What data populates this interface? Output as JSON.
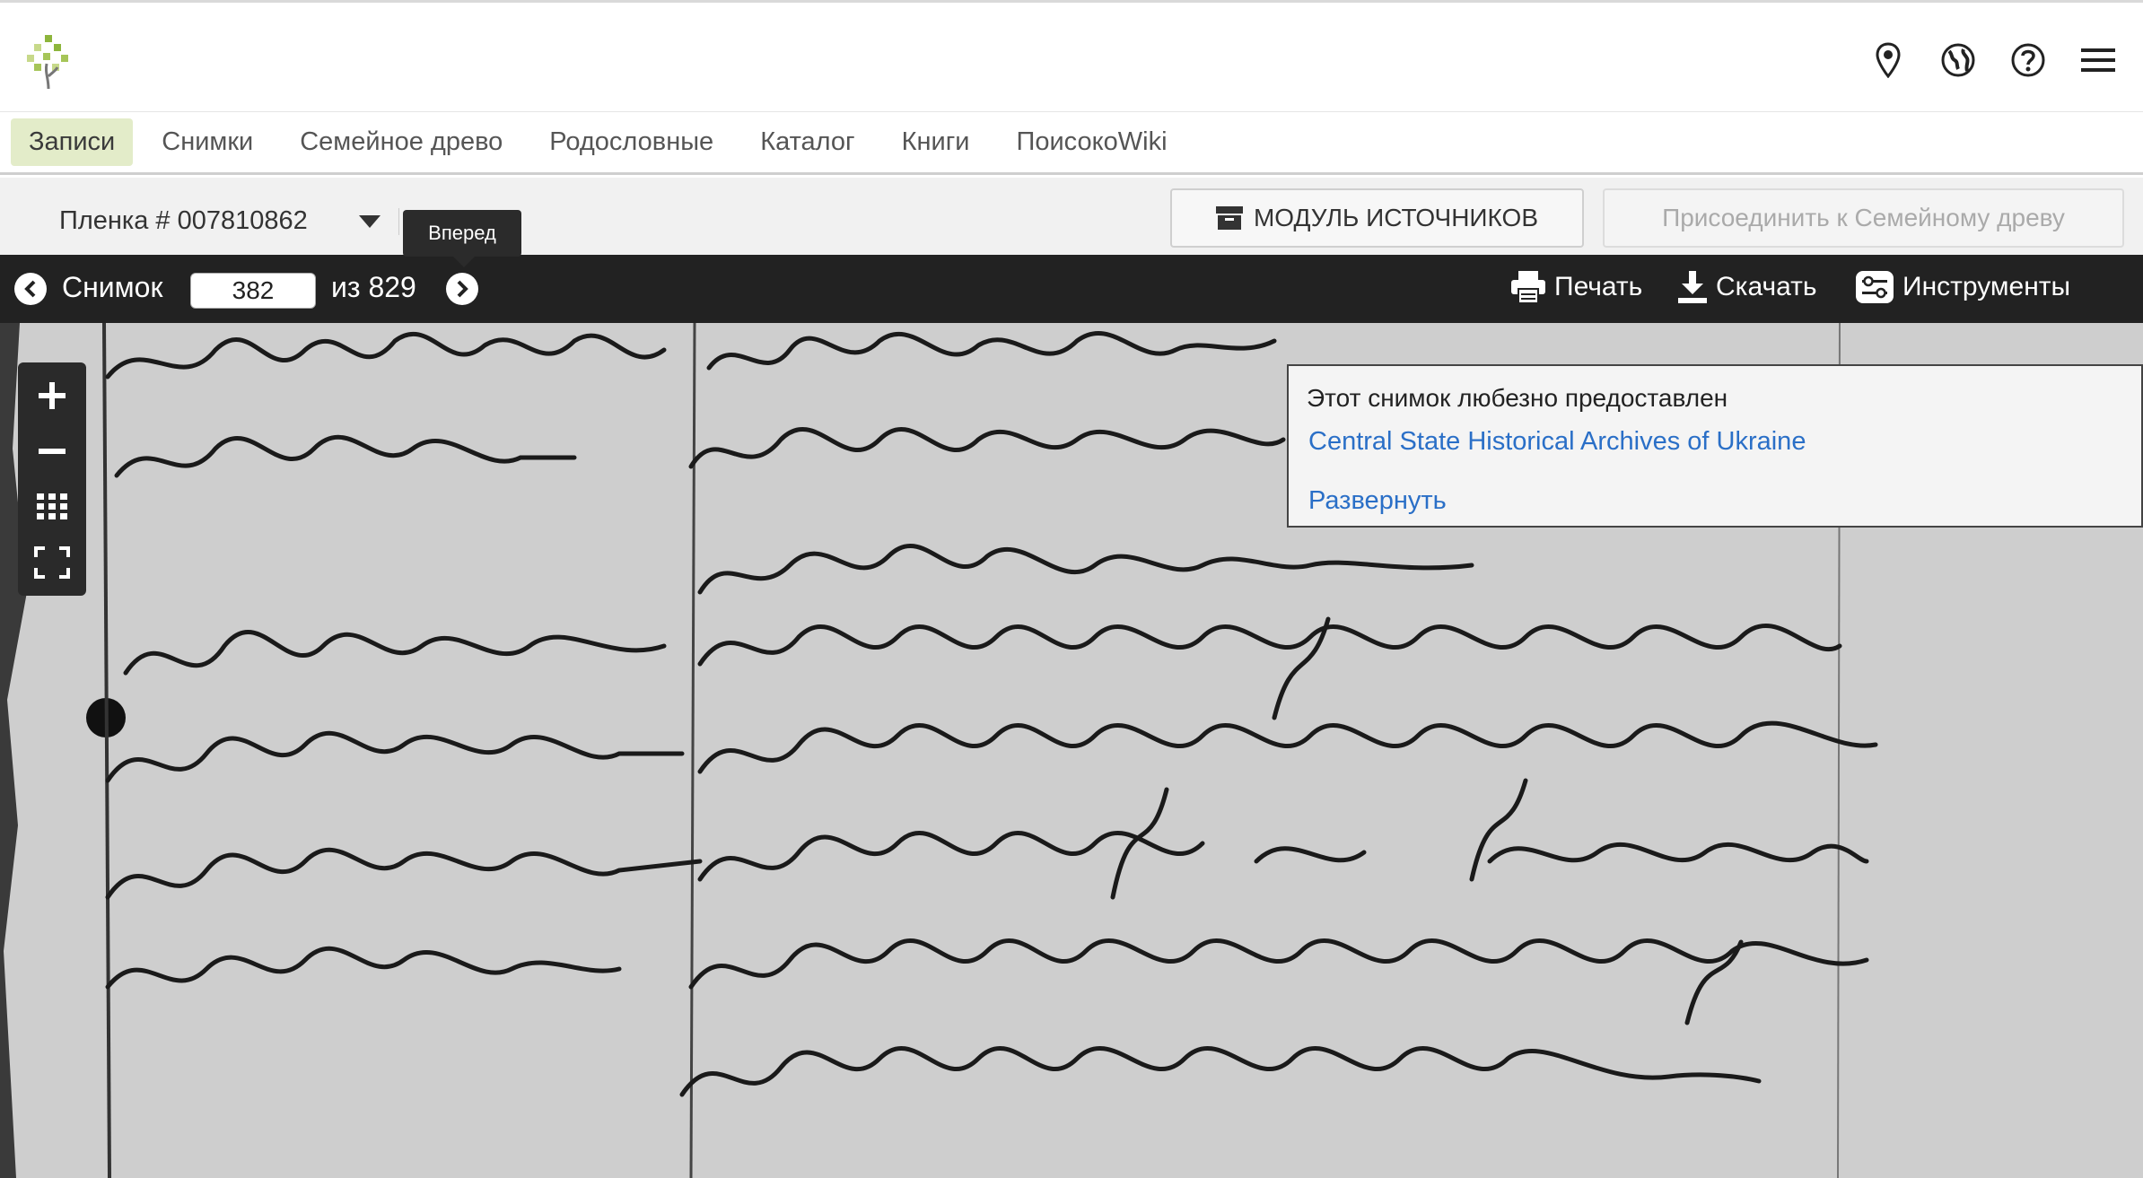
{
  "header": {
    "logo": "familysearch-tree-logo",
    "icons": [
      "location-pin-icon",
      "globe-icon",
      "help-icon",
      "menu-icon"
    ]
  },
  "nav": {
    "items": [
      {
        "label": "Записи",
        "active": true
      },
      {
        "label": "Снимки"
      },
      {
        "label": "Семейное древо"
      },
      {
        "label": "Родословные"
      },
      {
        "label": "Каталог"
      },
      {
        "label": "Книги"
      },
      {
        "label": "ПоисокоWiki"
      }
    ]
  },
  "film": {
    "label": "Пленка # 007810862",
    "tooltip": "Вперед",
    "source_button": "МОДУЛЬ ИСТОЧНИКОВ",
    "attach_button": "Присоединить к Семейному древу"
  },
  "viewer_bar": {
    "image_label": "Снимок",
    "current_image": "382",
    "total_label": "из 829",
    "print": "Печать",
    "download": "Скачать",
    "tools": "Инструменты"
  },
  "info_panel": {
    "courtesy": "Этот снимок любезно предоставлен",
    "archive": "Central State Historical Archives of Ukraine",
    "expand": "Развернуть"
  },
  "colors": {
    "accent_green": "#e3ecc9",
    "link_blue": "#2a6fc7",
    "toolbar_dark": "#222222"
  }
}
